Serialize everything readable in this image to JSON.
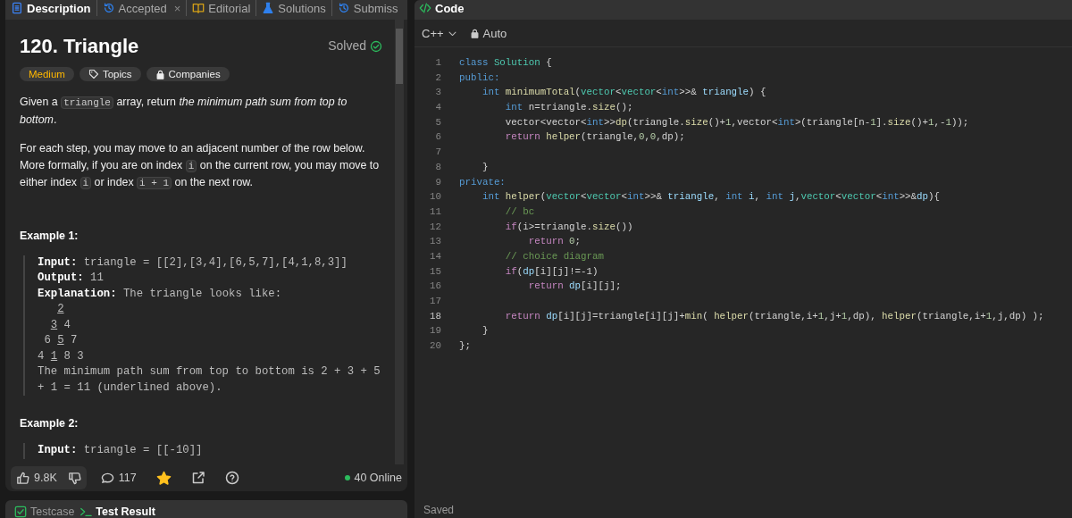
{
  "left_tabs": [
    {
      "label": "Description",
      "selected": true
    },
    {
      "label": "Accepted",
      "selected": false,
      "close": "×"
    },
    {
      "label": "Editorial",
      "selected": false
    },
    {
      "label": "Solutions",
      "selected": false
    },
    {
      "label": "Submiss",
      "selected": false
    }
  ],
  "problem": {
    "title": "120. Triangle",
    "status": "Solved",
    "tags": [
      {
        "label": "Medium",
        "kind": "difficulty"
      },
      {
        "label": "Topics",
        "kind": "topics"
      },
      {
        "label": "Companies",
        "kind": "companies"
      }
    ],
    "paragraphs": [
      [
        {
          "kind": "text",
          "text": "Given a "
        },
        {
          "kind": "code",
          "text": "triangle"
        },
        {
          "kind": "text",
          "text": " array, return "
        },
        {
          "kind": "em",
          "text": "the minimum path sum from top to bottom"
        },
        {
          "kind": "text",
          "text": "."
        }
      ],
      [
        {
          "kind": "text",
          "text": "For each step, you may move to an adjacent number of the row below. More formally, if you are on index "
        },
        {
          "kind": "code",
          "text": "i"
        },
        {
          "kind": "text",
          "text": " on the current row, you may move to either index "
        },
        {
          "kind": "code",
          "text": "i"
        },
        {
          "kind": "text",
          "text": " or index "
        },
        {
          "kind": "code",
          "text": "i + 1"
        },
        {
          "kind": "text",
          "text": " on the next row."
        }
      ]
    ],
    "examples": [
      {
        "heading": "Example 1:",
        "input": "**Input:** triangle = [[2],[3,4],[6,5,7],[4,1,8,3]]",
        "output": "**Output:** 11",
        "explanation": "**Explanation:** The triangle looks like:",
        "rows": [
          [
            {
              "text": "2",
              "underlined": true
            }
          ],
          [
            {
              "text": "3",
              "underlined": true
            },
            {
              "text": "4",
              "underlined": false
            }
          ],
          [
            {
              "text": "6",
              "underlined": false
            },
            {
              "text": "5",
              "underlined": true
            },
            {
              "text": "7",
              "underlined": false
            }
          ],
          [
            {
              "text": "4",
              "underlined": false
            },
            {
              "text": "1",
              "underlined": true
            },
            {
              "text": "8",
              "underlined": false
            },
            {
              "text": "3",
              "underlined": false
            }
          ]
        ],
        "note": "The minimum path sum from top to bottom is 2 + 3 + 5 + 1 = 11 (underlined above)."
      },
      {
        "heading": "Example 2:",
        "input": "**Input:** triangle = [[-10]]"
      }
    ]
  },
  "footer": {
    "likes": "9.8K",
    "comments": "117",
    "starred": true,
    "online": "40 Online"
  },
  "bottom_tabs": [
    {
      "label": "Testcase",
      "selected": false
    },
    {
      "label": "Test Result",
      "selected": true
    }
  ],
  "code_panel": {
    "title": "Code",
    "language": "C++",
    "mode": "Auto",
    "status": "Saved",
    "lines": [
      {
        "n": "1",
        "tokens": [
          {
            "kind": "kw",
            "text": "class "
          },
          {
            "kind": "type",
            "text": "Solution"
          },
          {
            "kind": "p",
            "text": " {"
          }
        ]
      },
      {
        "n": "2",
        "tokens": [
          {
            "kind": "kw",
            "text": "public:"
          }
        ]
      },
      {
        "n": "3",
        "tokens": [
          {
            "kind": "kw",
            "text": "    int "
          },
          {
            "kind": "fn",
            "text": "minimumTotal"
          },
          {
            "kind": "p",
            "text": "("
          },
          {
            "kind": "type",
            "text": "vector"
          },
          {
            "kind": "p",
            "text": "<"
          },
          {
            "kind": "type",
            "text": "vector"
          },
          {
            "kind": "p",
            "text": "<"
          },
          {
            "kind": "kw",
            "text": "int"
          },
          {
            "kind": "p",
            "text": ">>& "
          },
          {
            "kind": "var",
            "text": "triangle"
          },
          {
            "kind": "p",
            "text": ") {"
          }
        ]
      },
      {
        "n": "4",
        "tokens": [
          {
            "kind": "kw",
            "text": "        int "
          },
          {
            "kind": "p",
            "text": "n=triangle."
          },
          {
            "kind": "fn",
            "text": "size"
          },
          {
            "kind": "p",
            "text": "();"
          }
        ]
      },
      {
        "n": "5",
        "tokens": [
          {
            "kind": "p",
            "text": "        vector<vector<"
          },
          {
            "kind": "kw",
            "text": "int"
          },
          {
            "kind": "p",
            "text": ">>"
          },
          {
            "kind": "fn",
            "text": "dp"
          },
          {
            "kind": "p",
            "text": "(triangle."
          },
          {
            "kind": "fn",
            "text": "size"
          },
          {
            "kind": "p",
            "text": "()+"
          },
          {
            "kind": "num",
            "text": "1"
          },
          {
            "kind": "p",
            "text": ",vector<"
          },
          {
            "kind": "kw",
            "text": "int"
          },
          {
            "kind": "p",
            "text": ">(triangle[n-"
          },
          {
            "kind": "num",
            "text": "1"
          },
          {
            "kind": "p",
            "text": "]."
          },
          {
            "kind": "fn",
            "text": "size"
          },
          {
            "kind": "p",
            "text": "()+"
          },
          {
            "kind": "num",
            "text": "1"
          },
          {
            "kind": "p",
            "text": ",-"
          },
          {
            "kind": "num",
            "text": "1"
          },
          {
            "kind": "p",
            "text": "));"
          }
        ]
      },
      {
        "n": "6",
        "tokens": [
          {
            "kind": "ctrl",
            "text": "        return "
          },
          {
            "kind": "fn",
            "text": "helper"
          },
          {
            "kind": "p",
            "text": "(triangle,"
          },
          {
            "kind": "num",
            "text": "0"
          },
          {
            "kind": "p",
            "text": ","
          },
          {
            "kind": "num",
            "text": "0"
          },
          {
            "kind": "p",
            "text": ",dp);"
          }
        ]
      },
      {
        "n": "7"
      },
      {
        "n": "8",
        "tokens": [
          {
            "kind": "p",
            "text": "    }"
          }
        ]
      },
      {
        "n": "9",
        "tokens": [
          {
            "kind": "kw",
            "text": "private:"
          }
        ]
      },
      {
        "n": "10",
        "tokens": [
          {
            "kind": "kw",
            "text": "    int "
          },
          {
            "kind": "fn",
            "text": "helper"
          },
          {
            "kind": "p",
            "text": "("
          },
          {
            "kind": "type",
            "text": "vector"
          },
          {
            "kind": "p",
            "text": "<"
          },
          {
            "kind": "type",
            "text": "vector"
          },
          {
            "kind": "p",
            "text": "<"
          },
          {
            "kind": "kw",
            "text": "int"
          },
          {
            "kind": "p",
            "text": ">>& "
          },
          {
            "kind": "var",
            "text": "triangle"
          },
          {
            "kind": "p",
            "text": ", "
          },
          {
            "kind": "kw",
            "text": "int "
          },
          {
            "kind": "var",
            "text": "i"
          },
          {
            "kind": "p",
            "text": ", "
          },
          {
            "kind": "kw",
            "text": "int "
          },
          {
            "kind": "var",
            "text": "j"
          },
          {
            "kind": "p",
            "text": ","
          },
          {
            "kind": "type",
            "text": "vector"
          },
          {
            "kind": "p",
            "text": "<"
          },
          {
            "kind": "type",
            "text": "vector"
          },
          {
            "kind": "p",
            "text": "<"
          },
          {
            "kind": "kw",
            "text": "int"
          },
          {
            "kind": "p",
            "text": ">>&"
          },
          {
            "kind": "var",
            "text": "dp"
          },
          {
            "kind": "p",
            "text": "){"
          }
        ]
      },
      {
        "n": "11",
        "tokens": [
          {
            "kind": "cm",
            "text": "        // bc"
          }
        ]
      },
      {
        "n": "12",
        "tokens": [
          {
            "kind": "ctrl",
            "text": "        if"
          },
          {
            "kind": "p",
            "text": "(i>=triangle."
          },
          {
            "kind": "fn",
            "text": "size"
          },
          {
            "kind": "p",
            "text": "())"
          }
        ]
      },
      {
        "n": "13",
        "tokens": [
          {
            "kind": "ctrl",
            "text": "            return "
          },
          {
            "kind": "num",
            "text": "0"
          },
          {
            "kind": "p",
            "text": ";"
          }
        ]
      },
      {
        "n": "14",
        "tokens": [
          {
            "kind": "cm",
            "text": "        // choice diagram"
          }
        ]
      },
      {
        "n": "15",
        "tokens": [
          {
            "kind": "ctrl",
            "text": "        if"
          },
          {
            "kind": "p",
            "text": "("
          },
          {
            "kind": "var",
            "text": "dp"
          },
          {
            "kind": "p",
            "text": "[i][j]!=-1)"
          }
        ]
      },
      {
        "n": "16",
        "tokens": [
          {
            "kind": "ctrl",
            "text": "            return "
          },
          {
            "kind": "var",
            "text": "dp"
          },
          {
            "kind": "p",
            "text": "[i][j];"
          }
        ]
      },
      {
        "n": "17"
      },
      {
        "n": "18",
        "tokens": [
          {
            "kind": "ctrl",
            "text": "        return "
          },
          {
            "kind": "var",
            "text": "dp"
          },
          {
            "kind": "p",
            "text": "[i][j]=triangle[i][j]+"
          },
          {
            "kind": "fn",
            "text": "min"
          },
          {
            "kind": "p",
            "text": "( "
          },
          {
            "kind": "fn",
            "text": "helper"
          },
          {
            "kind": "p",
            "text": "(triangle,i+"
          },
          {
            "kind": "num",
            "text": "1"
          },
          {
            "kind": "p",
            "text": ",j+"
          },
          {
            "kind": "num",
            "text": "1"
          },
          {
            "kind": "p",
            "text": ",dp), "
          },
          {
            "kind": "fn",
            "text": "helper"
          },
          {
            "kind": "p",
            "text": "(triangle,i+"
          },
          {
            "kind": "num",
            "text": "1"
          },
          {
            "kind": "p",
            "text": ",j,dp) );"
          }
        ]
      },
      {
        "n": "19",
        "tokens": [
          {
            "kind": "p",
            "text": "    }"
          }
        ]
      },
      {
        "n": "20",
        "tokens": [
          {
            "kind": "p",
            "text": "};"
          }
        ]
      }
    ]
  }
}
